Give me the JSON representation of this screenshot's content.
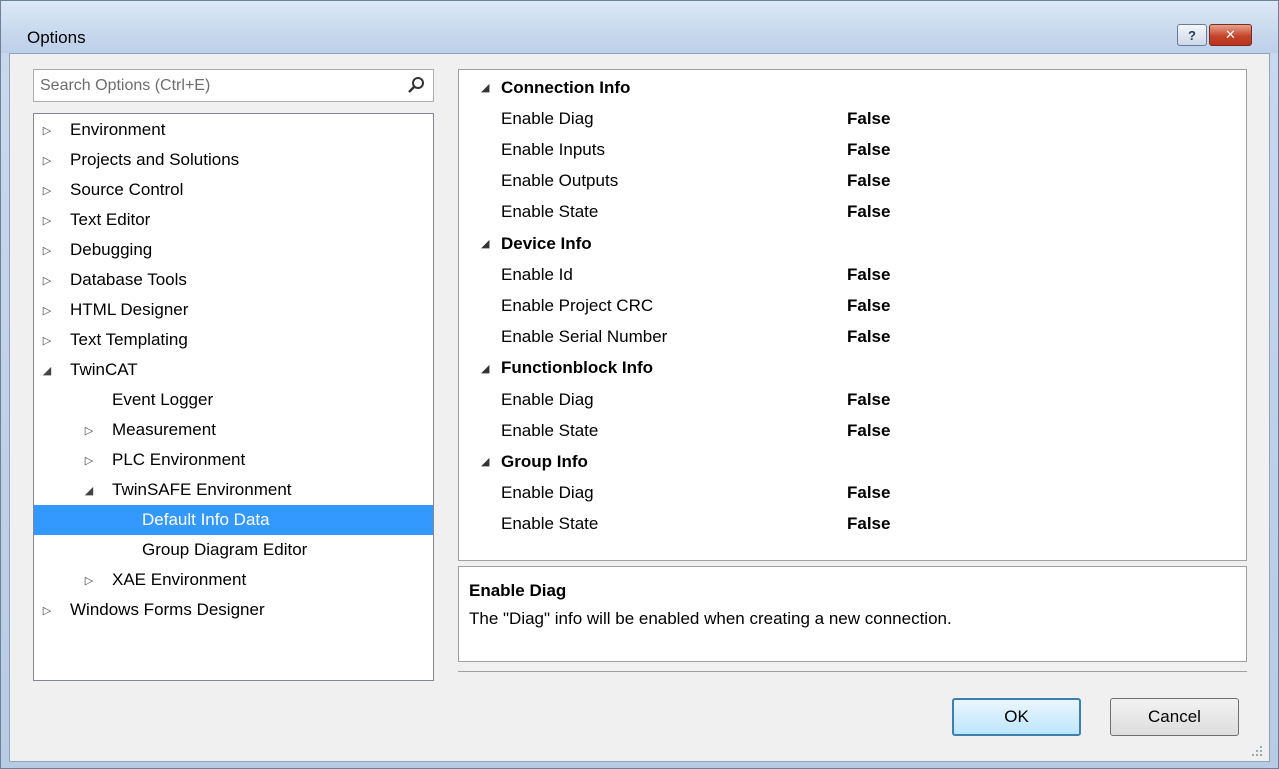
{
  "window": {
    "title": "Options",
    "help_label": "?",
    "close_label": "✕"
  },
  "search": {
    "placeholder": "Search Options (Ctrl+E)"
  },
  "tree": [
    {
      "label": "Environment",
      "level": 0,
      "state": "collapsed"
    },
    {
      "label": "Projects and Solutions",
      "level": 0,
      "state": "collapsed"
    },
    {
      "label": "Source Control",
      "level": 0,
      "state": "collapsed"
    },
    {
      "label": "Text Editor",
      "level": 0,
      "state": "collapsed"
    },
    {
      "label": "Debugging",
      "level": 0,
      "state": "collapsed"
    },
    {
      "label": "Database Tools",
      "level": 0,
      "state": "collapsed"
    },
    {
      "label": "HTML Designer",
      "level": 0,
      "state": "collapsed"
    },
    {
      "label": "Text Templating",
      "level": 0,
      "state": "collapsed"
    },
    {
      "label": "TwinCAT",
      "level": 0,
      "state": "expanded"
    },
    {
      "label": "Event Logger",
      "level": 1,
      "state": "leaf"
    },
    {
      "label": "Measurement",
      "level": 1,
      "state": "collapsed"
    },
    {
      "label": "PLC Environment",
      "level": 1,
      "state": "collapsed"
    },
    {
      "label": "TwinSAFE Environment",
      "level": 1,
      "state": "expanded"
    },
    {
      "label": "Default Info Data",
      "level": 2,
      "state": "leaf",
      "selected": true
    },
    {
      "label": "Group Diagram Editor",
      "level": 2,
      "state": "leaf"
    },
    {
      "label": "XAE Environment",
      "level": 1,
      "state": "collapsed"
    },
    {
      "label": "Windows Forms Designer",
      "level": 0,
      "state": "collapsed"
    }
  ],
  "properties": [
    {
      "category": "Connection Info",
      "items": [
        {
          "name": "Enable Diag",
          "value": "False"
        },
        {
          "name": "Enable Inputs",
          "value": "False"
        },
        {
          "name": "Enable Outputs",
          "value": "False"
        },
        {
          "name": "Enable State",
          "value": "False"
        }
      ]
    },
    {
      "category": "Device Info",
      "items": [
        {
          "name": "Enable Id",
          "value": "False"
        },
        {
          "name": "Enable Project CRC",
          "value": "False"
        },
        {
          "name": "Enable Serial Number",
          "value": "False"
        }
      ]
    },
    {
      "category": "Functionblock Info",
      "items": [
        {
          "name": "Enable Diag",
          "value": "False"
        },
        {
          "name": "Enable State",
          "value": "False"
        }
      ]
    },
    {
      "category": "Group Info",
      "items": [
        {
          "name": "Enable Diag",
          "value": "False"
        },
        {
          "name": "Enable State",
          "value": "False"
        }
      ]
    }
  ],
  "description": {
    "title": "Enable Diag",
    "text": "The \"Diag\" info will be enabled when creating a new connection."
  },
  "buttons": {
    "ok": "OK",
    "cancel": "Cancel"
  },
  "colors": {
    "selection": "#3399ff",
    "dialog_bg": "#f0f0f0"
  }
}
